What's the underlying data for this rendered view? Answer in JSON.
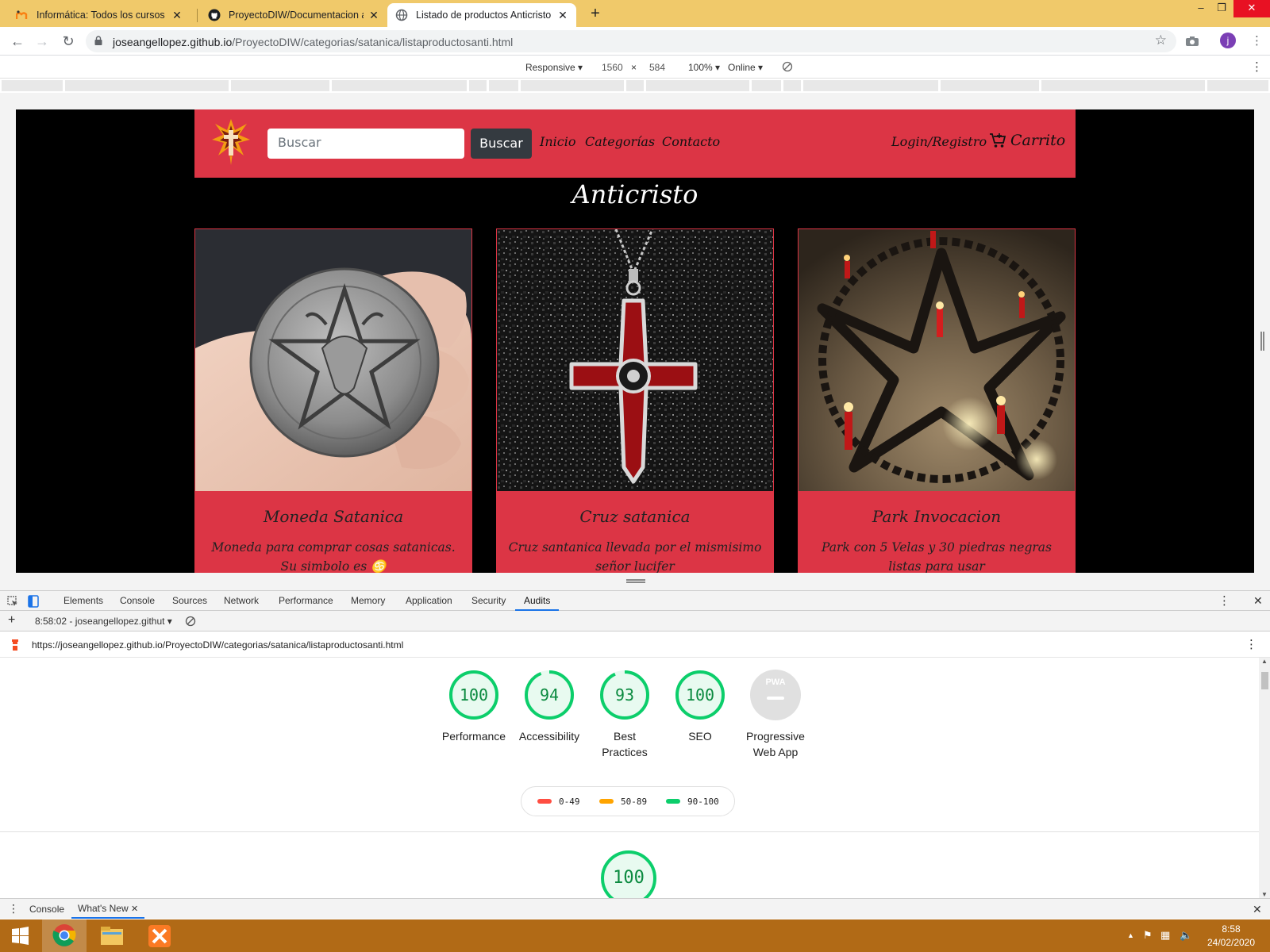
{
  "browser": {
    "tabs": [
      {
        "title": "Informática: Todos los cursos",
        "active": false
      },
      {
        "title": "ProyectoDIW/Documentacion at",
        "active": false
      },
      {
        "title": "Listado de productos Anticristo",
        "active": true
      }
    ],
    "url_host": "joseangellopez.github.io",
    "url_path": "/ProyectoDIW/categorias/satanica/listaproductosanti.html",
    "avatar_initial": "j"
  },
  "device_toolbar": {
    "mode": "Responsive",
    "width": "1560",
    "times": "×",
    "height": "584",
    "zoom": "100%",
    "network": "Online"
  },
  "site": {
    "search_placeholder": "Buscar",
    "search_button": "Buscar",
    "nav": [
      "Inicio",
      "Categorías",
      "Contacto"
    ],
    "login": "Login/Registro",
    "cart": "Carrito",
    "title": "Anticristo",
    "products": [
      {
        "name": "Moneda Satanica",
        "description": "Moneda para comprar cosas satanicas. Su simbolo es ♋"
      },
      {
        "name": "Cruz satanica",
        "description": "Cruz santanica llevada por el mismisimo señor lucifer"
      },
      {
        "name": "Park Invocacion",
        "description": "Park con 5 Velas y 30 piedras negras listas para usar"
      }
    ]
  },
  "devtools": {
    "tabs": [
      "Elements",
      "Console",
      "Sources",
      "Network",
      "Performance",
      "Memory",
      "Application",
      "Security",
      "Audits"
    ],
    "active_tab": "Audits",
    "report_select": "8:58:02 - joseangellopez.githut",
    "report_url": "https://joseangellopez.github.io/ProyectoDIW/categorias/satanica/listaproductosanti.html",
    "scores": [
      {
        "label_line1": "Performance",
        "label_line2": "",
        "score": "100",
        "value": 100
      },
      {
        "label_line1": "Accessibility",
        "label_line2": "",
        "score": "94",
        "value": 94
      },
      {
        "label_line1": "Best",
        "label_line2": "Practices",
        "score": "93",
        "value": 93
      },
      {
        "label_line1": "SEO",
        "label_line2": "",
        "score": "100",
        "value": 100
      },
      {
        "label_line1": "Progressive",
        "label_line2": "Web App",
        "score": "",
        "value": null
      }
    ],
    "pwa_badge": "PWA",
    "legend": [
      "0-49",
      "50-89",
      "90-100"
    ],
    "section_score": "100",
    "drawer_tabs": [
      "Console",
      "What's New"
    ]
  },
  "colors": {
    "brand_red": "#dc3545",
    "pass_green": "#0cce6b",
    "average_orange": "#ffa400",
    "fail_red": "#ff4e42",
    "taskbar": "#b16a16",
    "tabstrip": "#f0c96a"
  },
  "taskbar": {
    "time": "8:58",
    "date": "24/02/2020"
  }
}
